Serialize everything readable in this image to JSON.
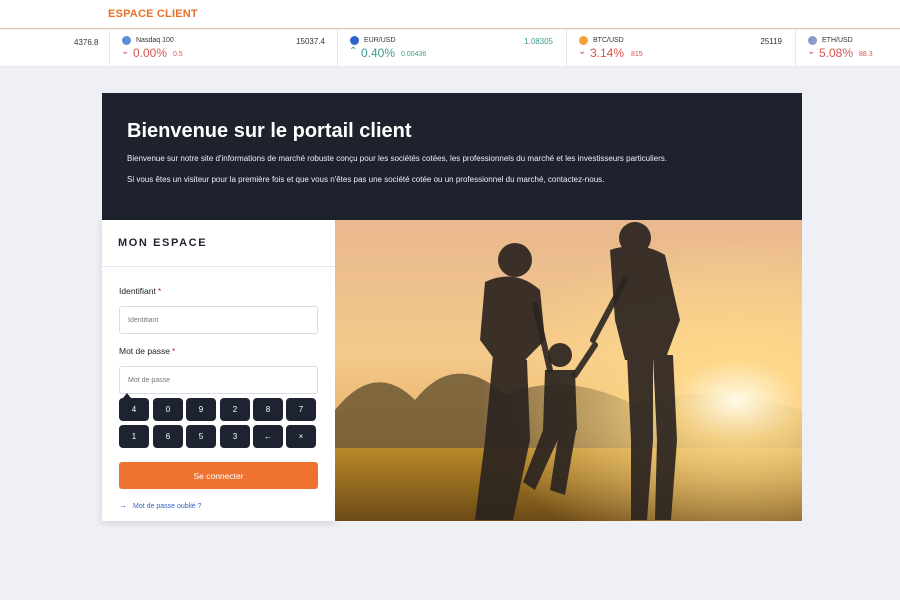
{
  "header": {
    "brand": "ESPACE CLIENT"
  },
  "ticker": {
    "first_value": "4376.8",
    "items": [
      {
        "name": "Nasdaq 100",
        "price": "15037.4",
        "pct": "0.00%",
        "delta": "0.5",
        "direction": "down",
        "icon": "nasdaq-icon",
        "icon_color": "#5a8fd8"
      },
      {
        "name": "EUR/USD",
        "price": "1.08305",
        "pct": "0.40%",
        "delta": "0.00436",
        "direction": "up",
        "icon": "currency-icon",
        "icon_color": "#2e64c7"
      },
      {
        "name": "BTC/USD",
        "price": "25119",
        "pct": "3.14%",
        "delta": "815",
        "direction": "down",
        "icon": "bitcoin-icon",
        "icon_color": "#f2a13b"
      },
      {
        "name": "ETH/USD",
        "price": "",
        "pct": "5.08%",
        "delta": "88.3",
        "direction": "down",
        "icon": "ethereum-icon",
        "icon_color": "#8d99c9"
      }
    ]
  },
  "hero": {
    "title": "Bienvenue sur le portail client",
    "line1": "Bienvenue sur notre site d'informations de marché robuste conçu pour les sociétés cotées, les professionnels du marché et les investisseurs particuliers.",
    "line2": "Si vous êtes un visiteur pour la première fois et que vous n'êtes pas une société cotée ou un professionnel du marché, contactez-nous."
  },
  "login": {
    "title": "MON ESPACE",
    "id_label": "Identifiant",
    "id_placeholder": "Identifiant",
    "pw_label": "Mot de passe",
    "pw_placeholder": "Mot de passe",
    "required_mark": "*",
    "keypad": [
      "4",
      "0",
      "9",
      "2",
      "8",
      "7",
      "1",
      "6",
      "5",
      "3",
      "←",
      "×"
    ],
    "submit": "Se connecter",
    "forgot": "Mot de passe oublié ?"
  },
  "colors": {
    "accent": "#ee7330",
    "dark": "#1d222c",
    "link": "#3465c8"
  }
}
